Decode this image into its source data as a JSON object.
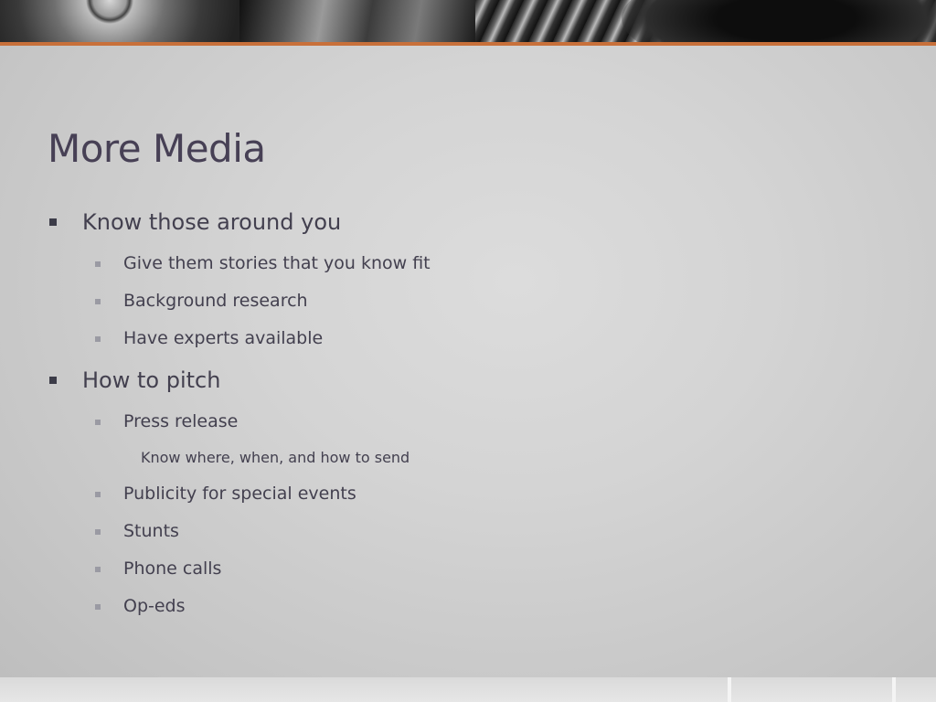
{
  "slide": {
    "title": "More Media",
    "bullets": [
      {
        "label": "Know those around you",
        "children": [
          {
            "label": "Give them stories that you know fit"
          },
          {
            "label": "Background research"
          },
          {
            "label": "Have experts available"
          }
        ]
      },
      {
        "label": "How to pitch",
        "children": [
          {
            "label": "Press release",
            "children": [
              {
                "label": "Know where, when, and how to send"
              }
            ]
          },
          {
            "label": "Publicity for special events"
          },
          {
            "label": "Stunts"
          },
          {
            "label": "Phone calls"
          },
          {
            "label": "Op-eds"
          }
        ]
      }
    ]
  },
  "theme": {
    "accent": "#c8703a",
    "title_color": "#474055",
    "text_color": "#43404f"
  }
}
